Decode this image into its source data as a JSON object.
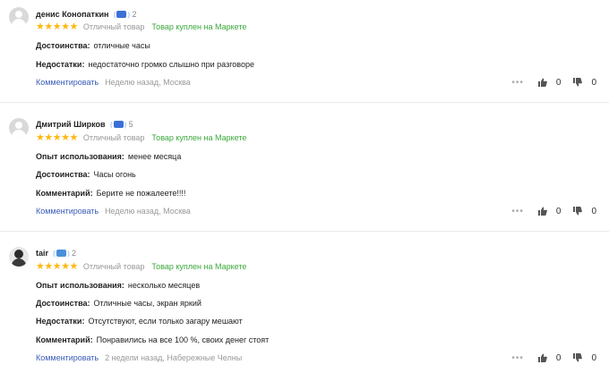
{
  "reviews": [
    {
      "author": "денис Конопаткин",
      "badge_count": "2",
      "badge_color": "#3b6fd8",
      "rating_text": "Отличный товар",
      "bought": "Товар куплен на Маркете",
      "stars": 5,
      "fields": [
        {
          "label": "Достоинства:",
          "value": "отличные часы"
        },
        {
          "label": "Недостатки:",
          "value": "недостаточно громко слышно при разговоре"
        }
      ],
      "comment_link": "Комментировать",
      "meta": "Неделю назад, Москва",
      "likes": "0",
      "dislikes": "0"
    },
    {
      "author": "Дмитрий Ширков",
      "badge_count": "5",
      "badge_color": "#3b6fd8",
      "rating_text": "Отличный товар",
      "bought": "Товар куплен на Маркете",
      "stars": 5,
      "fields": [
        {
          "label": "Опыт использования:",
          "value": "менее месяца"
        },
        {
          "label": "Достоинства:",
          "value": "Часы огонь"
        },
        {
          "label": "Комментарий:",
          "value": "Берите не пожалеете!!!!"
        }
      ],
      "comment_link": "Комментировать",
      "meta": "Неделю назад, Москва",
      "likes": "0",
      "dislikes": "0"
    },
    {
      "author": "tair",
      "badge_count": "2",
      "badge_color": "#4a90d9",
      "rating_text": "Отличный товар",
      "bought": "Товар куплен на Маркете",
      "stars": 5,
      "fields": [
        {
          "label": "Опыт использования:",
          "value": "несколько месяцев"
        },
        {
          "label": "Достоинства:",
          "value": "Отличные часы, экран яркий"
        },
        {
          "label": "Недостатки:",
          "value": "Отсутствуют, если только загару мешают"
        },
        {
          "label": "Комментарий:",
          "value": "Понравились на все 100 %, своих денег стоят"
        }
      ],
      "comment_link": "Комментировать",
      "meta": "2 недели назад, Набережные Челны",
      "likes": "0",
      "dislikes": "0"
    }
  ],
  "colors": {
    "stars": "#fdb913",
    "bought": "#3ba83b",
    "link": "#3a5bb8",
    "muted": "#999999"
  },
  "icons": {
    "avatar_default": "user-silhouette-icon",
    "like": "thumb-up-icon",
    "dislike": "thumb-down-icon",
    "more": "more-dots-icon",
    "badge": "medal-badge-icon"
  }
}
